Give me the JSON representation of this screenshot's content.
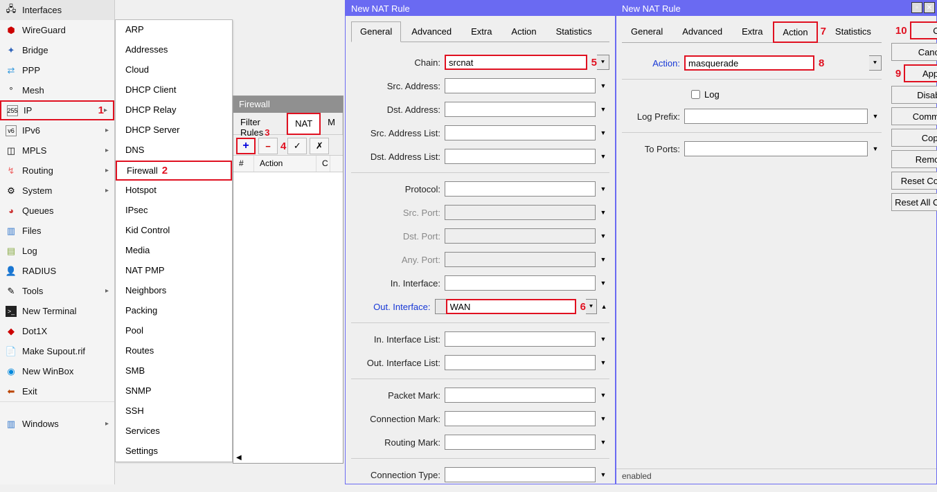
{
  "sidebar": {
    "items": [
      {
        "icon": "interfaces",
        "label": "Interfaces"
      },
      {
        "icon": "wireguard",
        "label": "WireGuard"
      },
      {
        "icon": "bridge",
        "label": "Bridge"
      },
      {
        "icon": "ppp",
        "label": "PPP"
      },
      {
        "icon": "mesh",
        "label": "Mesh"
      },
      {
        "icon": "ip",
        "label": "IP",
        "arrow": true
      },
      {
        "icon": "ipv6",
        "label": "IPv6",
        "arrow": true
      },
      {
        "icon": "mpls",
        "label": "MPLS",
        "arrow": true
      },
      {
        "icon": "routing",
        "label": "Routing",
        "arrow": true
      },
      {
        "icon": "system",
        "label": "System",
        "arrow": true
      },
      {
        "icon": "queues",
        "label": "Queues"
      },
      {
        "icon": "files",
        "label": "Files"
      },
      {
        "icon": "log",
        "label": "Log"
      },
      {
        "icon": "radius",
        "label": "RADIUS"
      },
      {
        "icon": "tools",
        "label": "Tools",
        "arrow": true
      },
      {
        "icon": "terminal",
        "label": "New Terminal"
      },
      {
        "icon": "dot1x",
        "label": "Dot1X"
      },
      {
        "icon": "supout",
        "label": "Make Supout.rif"
      },
      {
        "icon": "winbox",
        "label": "New WinBox"
      },
      {
        "icon": "exit",
        "label": "Exit"
      }
    ],
    "windows_label": "Windows"
  },
  "submenu": {
    "items": [
      "ARP",
      "Addresses",
      "Cloud",
      "DHCP Client",
      "DHCP Relay",
      "DHCP Server",
      "DNS",
      "Firewall",
      "Hotspot",
      "IPsec",
      "Kid Control",
      "Media",
      "NAT PMP",
      "Neighbors",
      "Packing",
      "Pool",
      "Routes",
      "SMB",
      "SNMP",
      "SSH",
      "Services",
      "Settings"
    ]
  },
  "firewall": {
    "title": "Firewall",
    "tabs": [
      "Filter Rules",
      "NAT",
      "M"
    ],
    "cols": [
      "#",
      "Action",
      "C"
    ]
  },
  "nat1": {
    "title": "New NAT Rule",
    "tabs": [
      "General",
      "Advanced",
      "Extra",
      "Action",
      "Statistics"
    ],
    "fields": {
      "chain": {
        "label": "Chain:",
        "value": "srcnat"
      },
      "src_addr": {
        "label": "Src. Address:"
      },
      "dst_addr": {
        "label": "Dst. Address:"
      },
      "src_addr_list": {
        "label": "Src. Address List:"
      },
      "dst_addr_list": {
        "label": "Dst. Address List:"
      },
      "protocol": {
        "label": "Protocol:"
      },
      "src_port": {
        "label": "Src. Port:"
      },
      "dst_port": {
        "label": "Dst. Port:"
      },
      "any_port": {
        "label": "Any. Port:"
      },
      "in_iface": {
        "label": "In. Interface:"
      },
      "out_iface": {
        "label": "Out. Interface:",
        "value": "WAN"
      },
      "in_iface_list": {
        "label": "In. Interface List:"
      },
      "out_iface_list": {
        "label": "Out. Interface List:"
      },
      "packet_mark": {
        "label": "Packet Mark:"
      },
      "conn_mark": {
        "label": "Connection Mark:"
      },
      "routing_mark": {
        "label": "Routing Mark:"
      },
      "conn_type": {
        "label": "Connection Type:"
      }
    }
  },
  "nat2": {
    "title": "New NAT Rule",
    "tabs": [
      "General",
      "Advanced",
      "Extra",
      "Action",
      "Statistics"
    ],
    "fields": {
      "action": {
        "label": "Action:",
        "value": "masquerade"
      },
      "log": {
        "label": "Log"
      },
      "log_prefix": {
        "label": "Log Prefix:"
      },
      "to_ports": {
        "label": "To Ports:"
      }
    },
    "buttons": [
      "OK",
      "Cancel",
      "Apply",
      "Disable",
      "Comment",
      "Copy",
      "Remove",
      "Reset Counters",
      "Reset All Counters"
    ],
    "status": "enabled"
  },
  "annotations": {
    "n1": "1",
    "n2": "2",
    "n3": "3",
    "n4": "4",
    "n5": "5",
    "n6": "6",
    "n7": "7",
    "n8": "8",
    "n9": "9",
    "n10": "10"
  }
}
